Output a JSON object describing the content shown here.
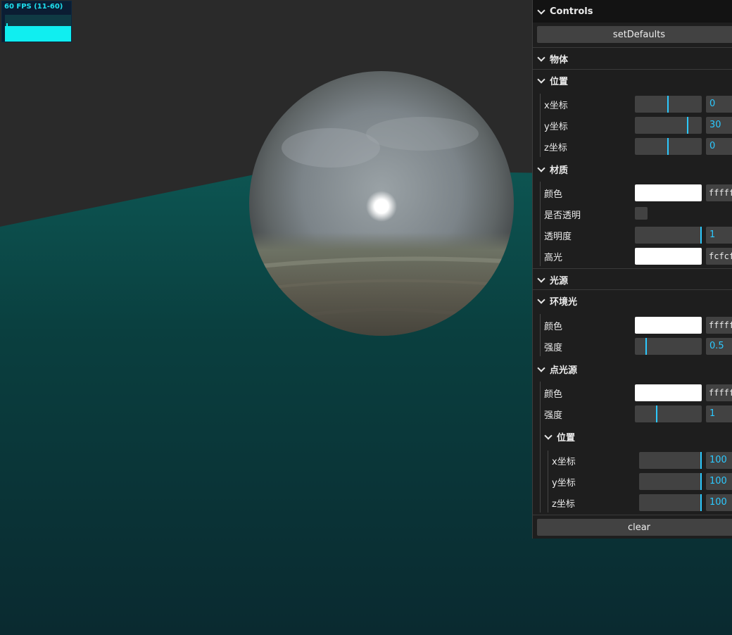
{
  "stats": {
    "fps_label": "60 FPS (11-60)"
  },
  "gui": {
    "title": "Controls",
    "set_defaults_label": "setDefaults",
    "clear_label": "clear",
    "object": {
      "title": "物体",
      "position": {
        "title": "位置",
        "x": {
          "label": "x坐标",
          "value": "0"
        },
        "y": {
          "label": "y坐标",
          "value": "30"
        },
        "z": {
          "label": "z坐标",
          "value": "0"
        }
      },
      "material": {
        "title": "材质",
        "color": {
          "label": "颜色",
          "value": "ffffff"
        },
        "transparent": {
          "label": "是否透明"
        },
        "opacity": {
          "label": "透明度",
          "value": "1"
        },
        "specular": {
          "label": "高光",
          "value": "fcfcfc"
        }
      }
    },
    "light": {
      "title": "光源",
      "ambient": {
        "title": "环境光",
        "color": {
          "label": "颜色",
          "value": "ffffff"
        },
        "intensity": {
          "label": "强度",
          "value": "0.5"
        }
      },
      "point": {
        "title": "点光源",
        "color": {
          "label": "颜色",
          "value": "ffffff"
        },
        "intensity": {
          "label": "强度",
          "value": "1"
        },
        "position": {
          "title": "位置",
          "x": {
            "label": "x坐标",
            "value": "100"
          },
          "y": {
            "label": "y坐标",
            "value": "100"
          },
          "z": {
            "label": "z坐标",
            "value": "100"
          }
        }
      }
    }
  },
  "colors": {
    "accent": "#2cc9ff",
    "fps": "#10eef0",
    "ground": "#0b4746",
    "background": "#2a2a2a"
  }
}
